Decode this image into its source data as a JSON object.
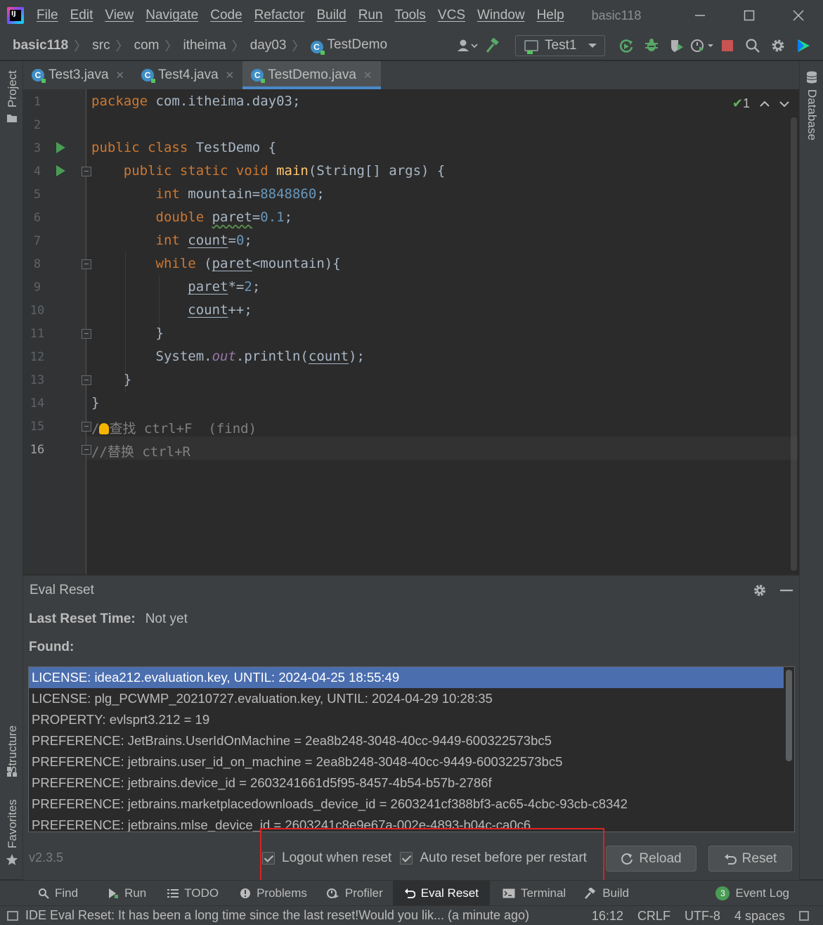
{
  "menubar": {
    "items": [
      "File",
      "Edit",
      "View",
      "Navigate",
      "Code",
      "Refactor",
      "Build",
      "Run",
      "Tools",
      "VCS",
      "Window",
      "Help"
    ],
    "window_title": "basic118"
  },
  "breadcrumb": [
    "basic118",
    "src",
    "com",
    "itheima",
    "day03",
    "TestDemo"
  ],
  "run_config": "Test1",
  "tabs": [
    {
      "label": "Test3.java",
      "active": false
    },
    {
      "label": "Test4.java",
      "active": false
    },
    {
      "label": "TestDemo.java",
      "active": true
    }
  ],
  "left_strip": {
    "project": "Project",
    "structure": "Structure",
    "favorites": "Favorites"
  },
  "right_strip": {
    "database": "Database"
  },
  "editor": {
    "inspection_count": "1",
    "line_numbers": [
      "1",
      "2",
      "3",
      "4",
      "5",
      "6",
      "7",
      "8",
      "9",
      "10",
      "11",
      "12",
      "13",
      "14",
      "15",
      "16"
    ],
    "current_line": 16
  },
  "eval_reset": {
    "title": "Eval Reset",
    "last_reset_label": "Last Reset Time:",
    "last_reset_value": "Not yet",
    "found_label": "Found:",
    "found_items": [
      "LICENSE: idea212.evaluation.key, UNTIL: 2024-04-25 18:55:49",
      "LICENSE: plg_PCWMP_20210727.evaluation.key, UNTIL: 2024-04-29 10:28:35",
      "PROPERTY: evlsprt3.212 = 19",
      "PREFERENCE: JetBrains.UserIdOnMachine = 2ea8b248-3048-40cc-9449-600322573bc5",
      "PREFERENCE: jetbrains.user_id_on_machine = 2ea8b248-3048-40cc-9449-600322573bc5",
      "PREFERENCE: jetbrains.device_id = 2603241661d5f95-8457-4b54-b57b-2786f",
      "PREFERENCE: jetbrains.marketplacedownloads_device_id = 2603241cf388bf3-ac65-4cbc-93cb-c8342",
      "PREFERENCE: jetbrains.mlse_device_id = 2603241c8e9e67a-002e-4893-b04c-ca0c6"
    ],
    "version": "v2.3.5",
    "logout_label": "Logout when reset",
    "auto_reset_label": "Auto reset before per restart",
    "logout_checked": true,
    "auto_reset_checked": true,
    "reload_label": "Reload",
    "reset_label": "Reset"
  },
  "tool_windows": [
    "Find",
    "Run",
    "TODO",
    "Problems",
    "Profiler",
    "Eval Reset",
    "Terminal",
    "Build"
  ],
  "event_log": {
    "label": "Event Log",
    "count": "3"
  },
  "status": {
    "message": "IDE Eval Reset: It has been a long time since the last reset!Would you lik... (a minute ago)",
    "position": "16:12",
    "line_sep": "CRLF",
    "encoding": "UTF-8",
    "indent": "4 spaces"
  }
}
